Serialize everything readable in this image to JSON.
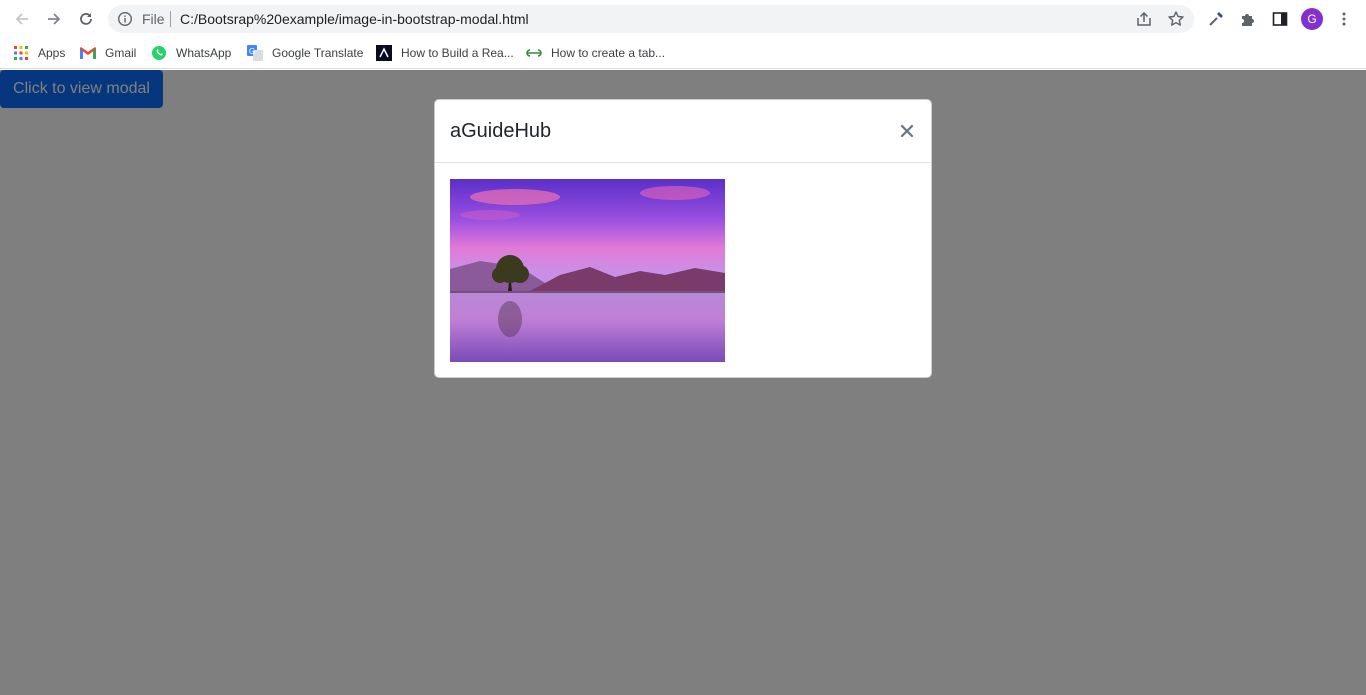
{
  "browser": {
    "omnibox": {
      "scheme_label": "File",
      "url": "C:/Bootsrap%20example/image-in-bootstrap-modal.html"
    },
    "profile_initial": "G",
    "profile_color": "#8430ce",
    "icons": [
      "back-icon",
      "forward-icon",
      "reload-icon",
      "info-icon",
      "share-icon",
      "star-icon",
      "eyedropper-icon",
      "extensions-icon",
      "side-panel-icon",
      "menu-icon"
    ]
  },
  "bookmarks": [
    {
      "label": "Apps",
      "icon": "apps-grid-icon"
    },
    {
      "label": "Gmail",
      "icon": "gmail-icon"
    },
    {
      "label": "WhatsApp",
      "icon": "whatsapp-icon"
    },
    {
      "label": "Google Translate",
      "icon": "google-translate-icon"
    },
    {
      "label": "How to Build a Rea...",
      "icon": "site-favicon-icon"
    },
    {
      "label": "How to create a tab...",
      "icon": "gfg-icon"
    }
  ],
  "page": {
    "open_button_label": "Click to view modal",
    "accent_color": "#0d6efd"
  },
  "modal": {
    "title": "aGuideHub",
    "close_icon": "close-icon",
    "image_alt": "Purple sunset lake with lone tree and mountains"
  }
}
